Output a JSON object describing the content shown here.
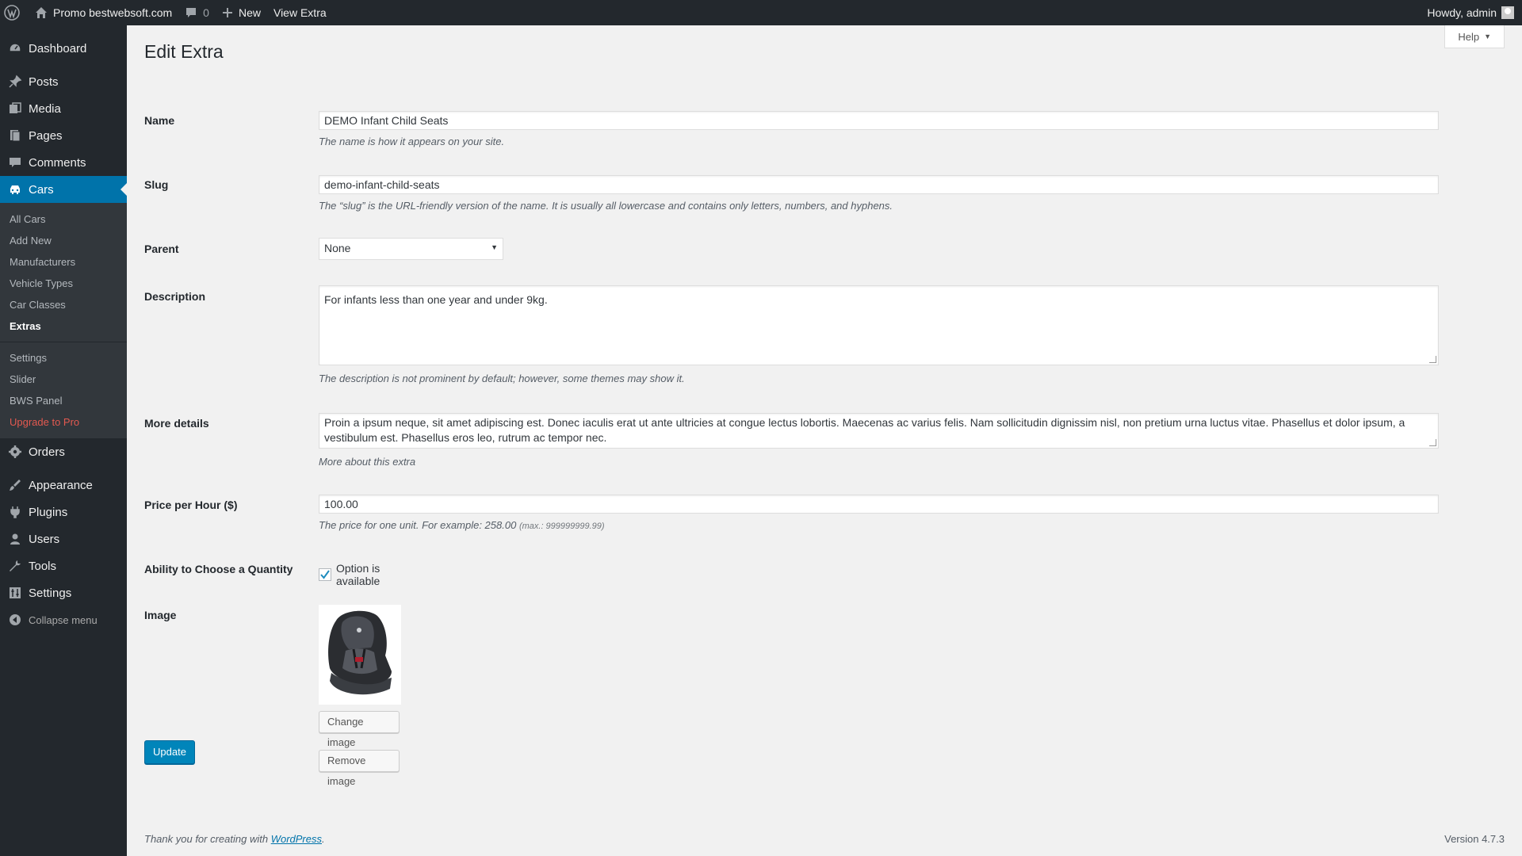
{
  "adminbar": {
    "site_name": "Promo bestwebsoft.com",
    "comments_count": "0",
    "new_label": "New",
    "view_label": "View Extra",
    "howdy": "Howdy, admin"
  },
  "sidebar": {
    "items": [
      {
        "label": "Dashboard",
        "icon": "dashboard-icon"
      },
      {
        "label": "Posts",
        "icon": "pin-icon"
      },
      {
        "label": "Media",
        "icon": "media-icon"
      },
      {
        "label": "Pages",
        "icon": "pages-icon"
      },
      {
        "label": "Comments",
        "icon": "comments-icon"
      },
      {
        "label": "Cars",
        "icon": "car-icon"
      },
      {
        "label": "Orders",
        "icon": "gear-icon"
      },
      {
        "label": "Appearance",
        "icon": "brush-icon"
      },
      {
        "label": "Plugins",
        "icon": "plug-icon"
      },
      {
        "label": "Users",
        "icon": "user-icon"
      },
      {
        "label": "Tools",
        "icon": "wrench-icon"
      },
      {
        "label": "Settings",
        "icon": "settings-icon"
      },
      {
        "label": "Collapse menu",
        "icon": "collapse-icon"
      }
    ],
    "cars_sub": [
      "All Cars",
      "Add New",
      "Manufacturers",
      "Vehicle Types",
      "Car Classes",
      "Extras"
    ],
    "cars_sub2": [
      "Settings",
      "Slider",
      "BWS Panel",
      "Upgrade to Pro"
    ]
  },
  "help": "Help",
  "page_title": "Edit Extra",
  "form": {
    "name_label": "Name",
    "name_value": "DEMO Infant Child Seats",
    "name_desc": "The name is how it appears on your site.",
    "slug_label": "Slug",
    "slug_value": "demo-infant-child-seats",
    "slug_desc": "The “slug” is the URL-friendly version of the name. It is usually all lowercase and contains only letters, numbers, and hyphens.",
    "parent_label": "Parent",
    "parent_value": "None",
    "description_label": "Description",
    "description_value": "For infants less than one year and under 9kg.",
    "description_desc": "The description is not prominent by default; however, some themes may show it.",
    "more_label": "More details",
    "more_value": "Proin a ipsum neque, sit amet adipiscing est. Donec iaculis erat ut ante ultricies at congue lectus lobortis. Maecenas ac varius felis. Nam sollicitudin dignissim nisl, non pretium urna luctus vitae. Phasellus et dolor ipsum, a vestibulum est. Phasellus eros leo, rutrum ac tempor nec.",
    "more_desc": "More about this extra",
    "price_label": "Price per Hour ($)",
    "price_value": "100.00",
    "price_desc": "The price for one unit. For example: 258.00",
    "price_max": "(max.: 999999999.99)",
    "quantity_label": "Ability to Choose a Quantity",
    "quantity_option": "Option is available",
    "quantity_checked": true,
    "image_label": "Image",
    "change_image": "Change image",
    "remove_image": "Remove image",
    "update": "Update"
  },
  "footer": {
    "thanks": "Thank you for creating with ",
    "link": "WordPress",
    "period": ".",
    "version": "Version 4.7.3"
  },
  "colors": {
    "sidebar_bg": "#23282d",
    "accent": "#0073aa",
    "primary_button": "#0085ba",
    "upgrade": "#e35950"
  }
}
